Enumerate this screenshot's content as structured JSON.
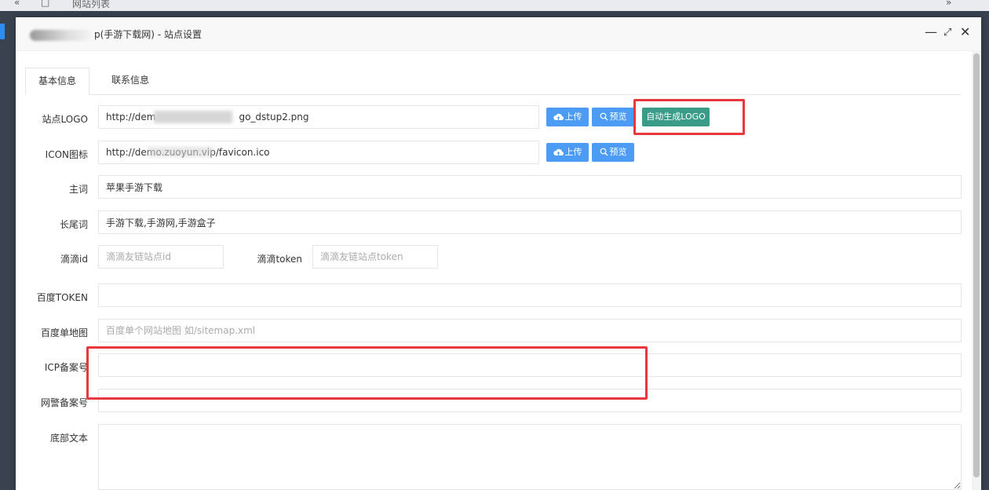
{
  "background": {
    "prev_glyph": "«",
    "next_glyph": "»",
    "tab_label": "网站列表"
  },
  "dialog": {
    "title": "p(手游下载网) - 站点设置",
    "controls": {
      "minimize": "—",
      "maximize": "⤢",
      "close": "✕"
    }
  },
  "tabs": [
    "基本信息",
    "联系信息"
  ],
  "form": {
    "logo": {
      "label": "站点LOGO",
      "value_prefix": "http://dem",
      "value_suffix": "go_dstup2.png"
    },
    "icon": {
      "label": "ICON图标",
      "value": "http://demo.zuoyun.vip/favicon.ico"
    },
    "upload_label": "上传",
    "preview_label": "预览",
    "auto_logo_label": "自动生成LOGO",
    "keyword": {
      "label": "主词",
      "value": "苹果手游下载"
    },
    "longtail": {
      "label": "长尾词",
      "value": "手游下载,手游网,手游盒子"
    },
    "didi_id": {
      "label": "滴滴id",
      "placeholder": "滴滴友链站点id"
    },
    "didi_token": {
      "label": "滴滴token",
      "placeholder": "滴滴友链站点token"
    },
    "baidu_token": {
      "label": "百度TOKEN",
      "value": ""
    },
    "baidu_sitemap": {
      "label": "百度单地图",
      "placeholder": "百度单个网站地图 如/sitemap.xml"
    },
    "icp": {
      "label": "ICP备案号",
      "value": ""
    },
    "police": {
      "label": "网警备案号",
      "value": ""
    },
    "footer": {
      "label": "底部文本",
      "value": ""
    }
  },
  "colors": {
    "primary_button": "#4c9bf5",
    "auto_logo_button": "#3a9b89",
    "highlight": "#e8373f"
  }
}
